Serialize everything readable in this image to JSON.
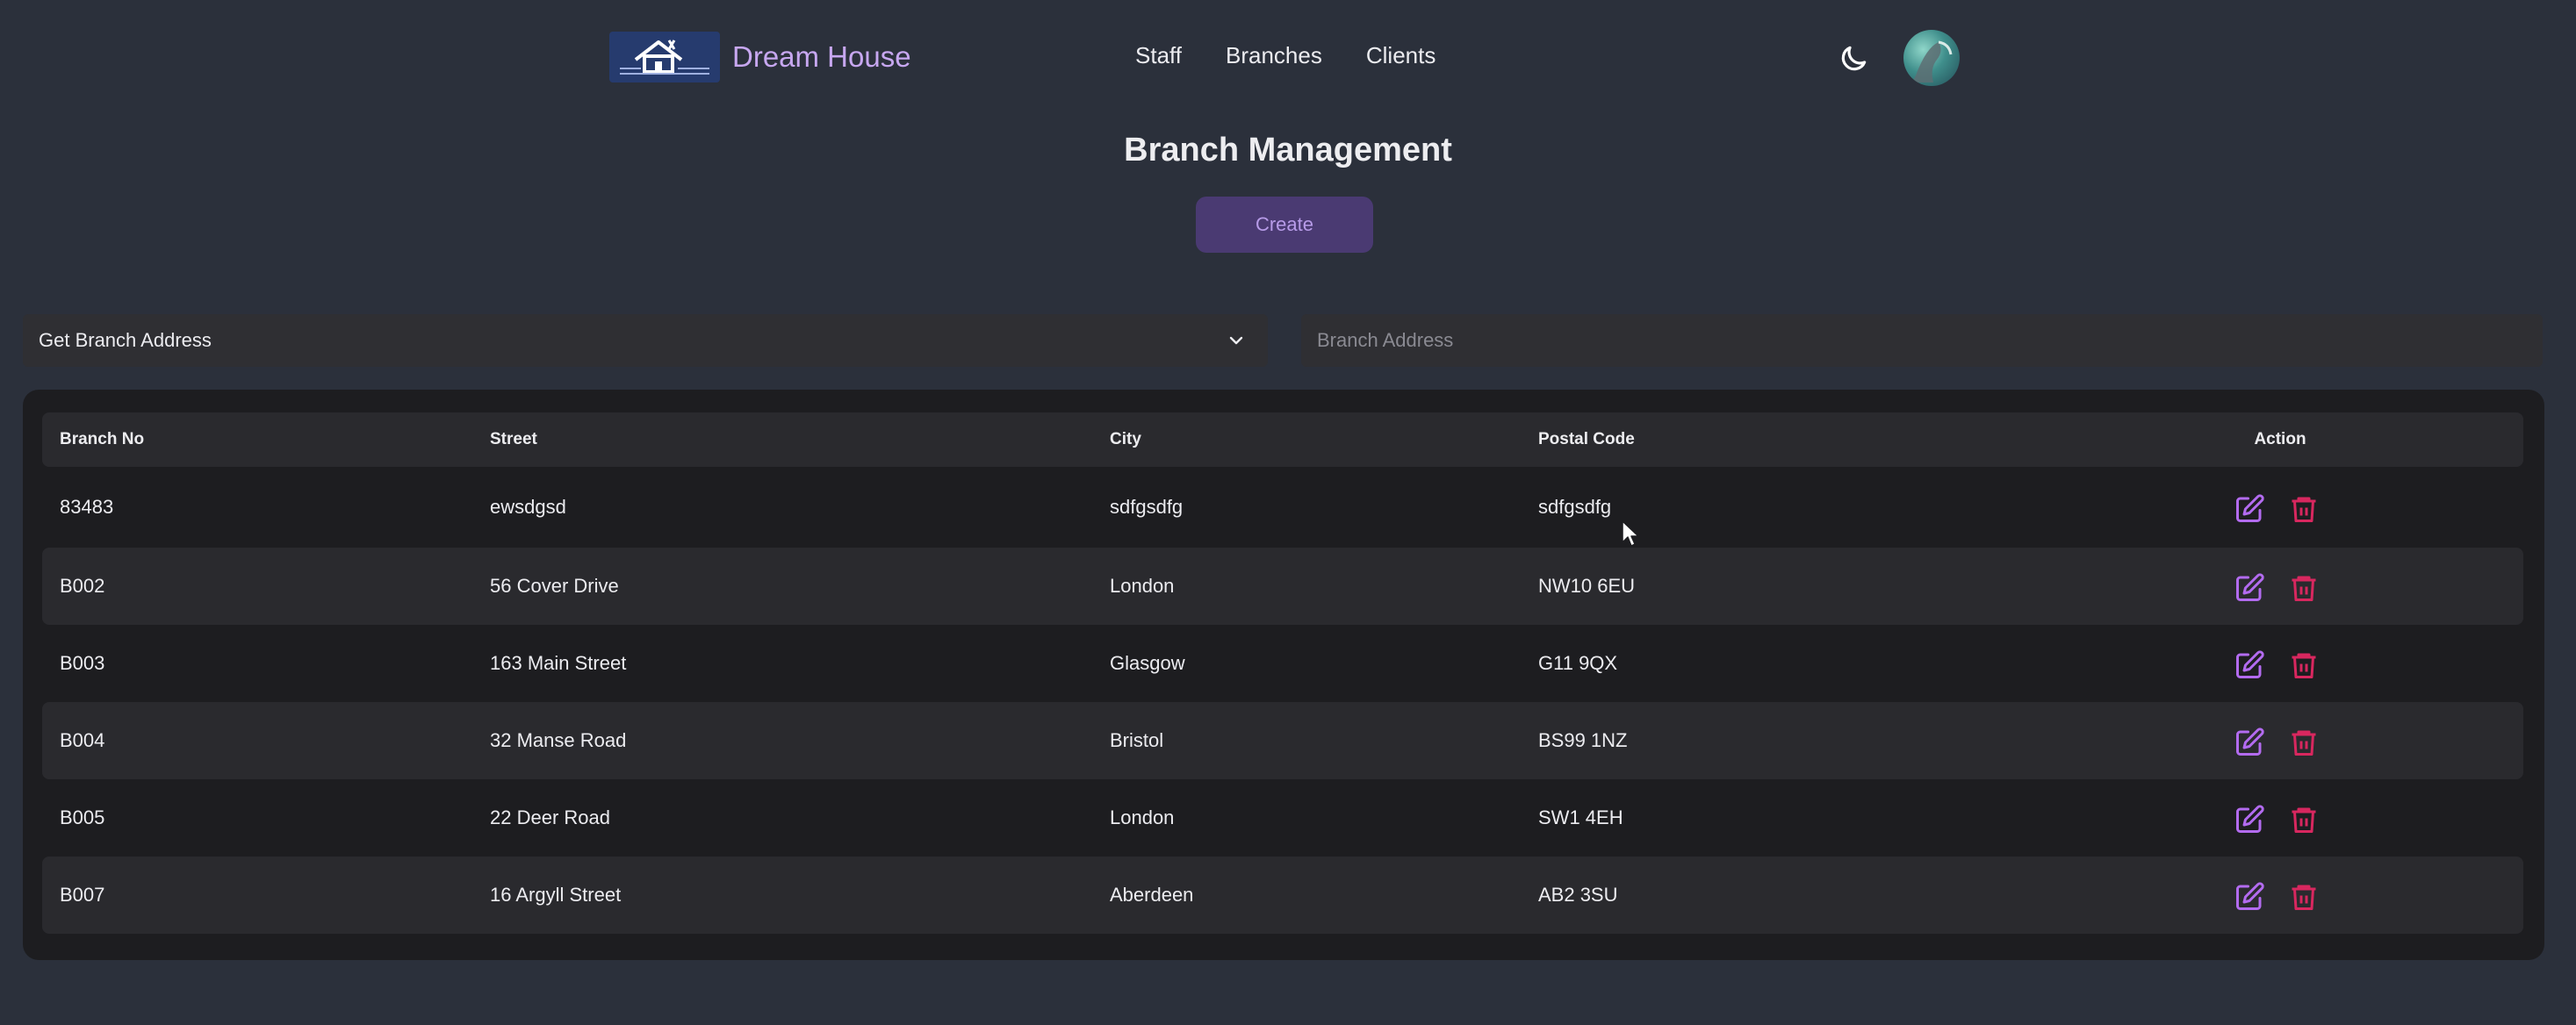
{
  "header": {
    "brand_name": "Dream House",
    "nav": [
      "Staff",
      "Branches",
      "Clients"
    ],
    "icons": {
      "logo": "house-logo-icon",
      "theme": "moon-icon",
      "avatar": "user-avatar"
    }
  },
  "page": {
    "title": "Branch Management",
    "create_label": "Create"
  },
  "filters": {
    "select_value": "Get Branch Address",
    "address_placeholder": "Branch Address",
    "address_value": ""
  },
  "table": {
    "columns": [
      "Branch No",
      "Street",
      "City",
      "Postal Code",
      "Action"
    ],
    "rows": [
      {
        "branch_no": "83483",
        "street": "ewsdgsd",
        "city": "sdfgsdfg",
        "postal_code": "sdfgsdfg"
      },
      {
        "branch_no": "B002",
        "street": "56 Cover Drive",
        "city": "London",
        "postal_code": "NW10 6EU"
      },
      {
        "branch_no": "B003",
        "street": "163 Main Street",
        "city": "Glasgow",
        "postal_code": "G11 9QX"
      },
      {
        "branch_no": "B004",
        "street": "32 Manse Road",
        "city": "Bristol",
        "postal_code": "BS99 1NZ"
      },
      {
        "branch_no": "B005",
        "street": "22 Deer Road",
        "city": "London",
        "postal_code": "SW1 4EH"
      },
      {
        "branch_no": "B007",
        "street": "16 Argyll Street",
        "city": "Aberdeen",
        "postal_code": "AB2 3SU"
      }
    ],
    "action_icons": [
      "edit-icon",
      "trash-icon"
    ]
  },
  "colors": {
    "background": "#2b303b",
    "accent_purple": "#b36bf0",
    "danger_red": "#d8275f",
    "brand_text": "#c7a7f0",
    "create_button": "#4a3a72"
  }
}
